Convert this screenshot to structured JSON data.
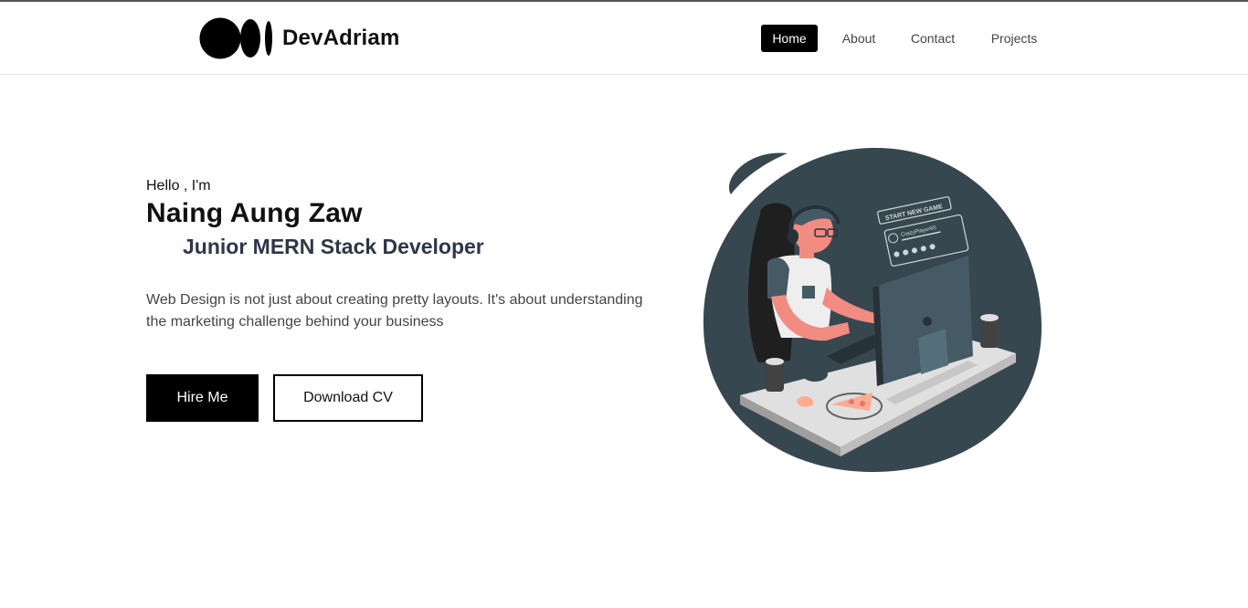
{
  "brand": {
    "name": "DevAdriam",
    "logo_icon": "medium-logo-icon"
  },
  "nav": {
    "items": [
      {
        "label": "Home",
        "active": true
      },
      {
        "label": "About",
        "active": false
      },
      {
        "label": "Contact",
        "active": false
      },
      {
        "label": "Projects",
        "active": false
      }
    ]
  },
  "hero": {
    "greeting": "Hello , I'm",
    "name": "Naing Aung Zaw",
    "role": "Junior MERN Stack Developer",
    "description": "Web Design is not just about creating pretty layouts. It's about understanding the marketing challenge behind your business",
    "primary_button": "Hire Me",
    "secondary_button": "Download CV"
  },
  "illustration": {
    "screen_title": "START NEW GAME",
    "player_name": "CrazyPlayer65"
  },
  "colors": {
    "accent": "#000000",
    "blob": "#37474f",
    "skin": "#f28b82",
    "desk": "#e0e0e0"
  }
}
